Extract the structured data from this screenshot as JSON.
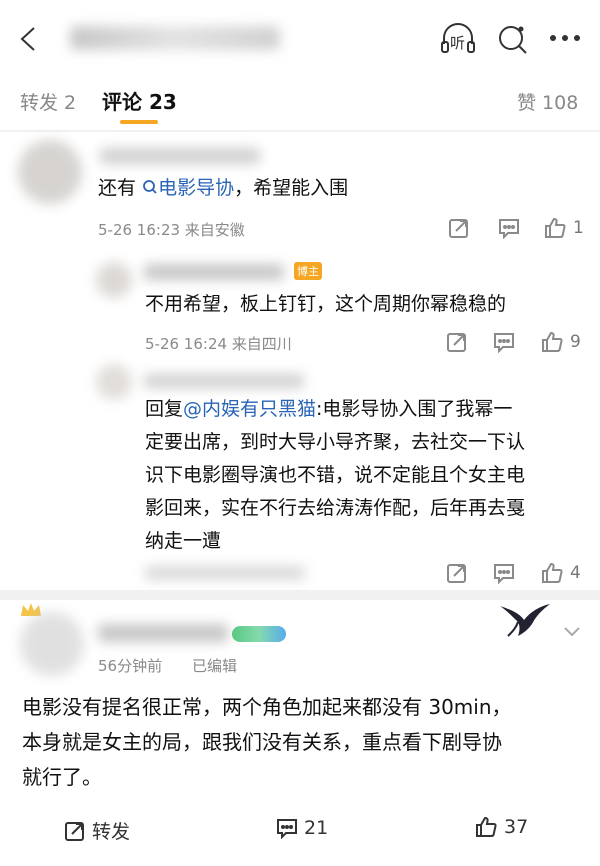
{
  "header": {
    "back_icon": "chevron-left-icon",
    "listen_label": "听",
    "listen_icon": "headphones-icon",
    "search_icon": "search-icon",
    "more_icon": "more-horizontal-icon"
  },
  "tabs": {
    "repost": "转发 2",
    "comments": "评论 23",
    "likes": "赞 108"
  },
  "comment1": {
    "text_prefix": "还有",
    "link": "电影导协",
    "text_suffix": "，希望能入围",
    "meta": "5-26 16:23 来自安徽",
    "like_count": "1"
  },
  "reply1": {
    "badge": "博主",
    "text": "不用希望，板上钉钉，这个周期你幂稳稳的",
    "meta": "5-26 16:24 来自四川",
    "like_count": "9"
  },
  "reply2": {
    "lines": [
      "回复@内娱有只黑猫:电影导协入围了我幂一",
      "定要出席，到时大导小导齐聚，去社交一下认",
      "识下电影圈导演也不错，说不定能且个女主电",
      "影回来，实在不行去给涛涛作配，后年再去戛",
      "纳走一遭"
    ],
    "mention": "@内娱有只黑猫",
    "like_count": "4"
  },
  "post": {
    "time": "56分钟前",
    "edited": "已编辑",
    "lines": [
      "电影没有提名很正常，两个角色加起来都没有 30min，",
      "本身就是女主的局，跟我们没有关系，重点看下剧导协",
      "就行了。"
    ],
    "repost_label": "转发",
    "comment_count": "21",
    "like_count": "37"
  },
  "colors": {
    "link": "#2a64b5",
    "tab_underline": "#f5a623"
  }
}
